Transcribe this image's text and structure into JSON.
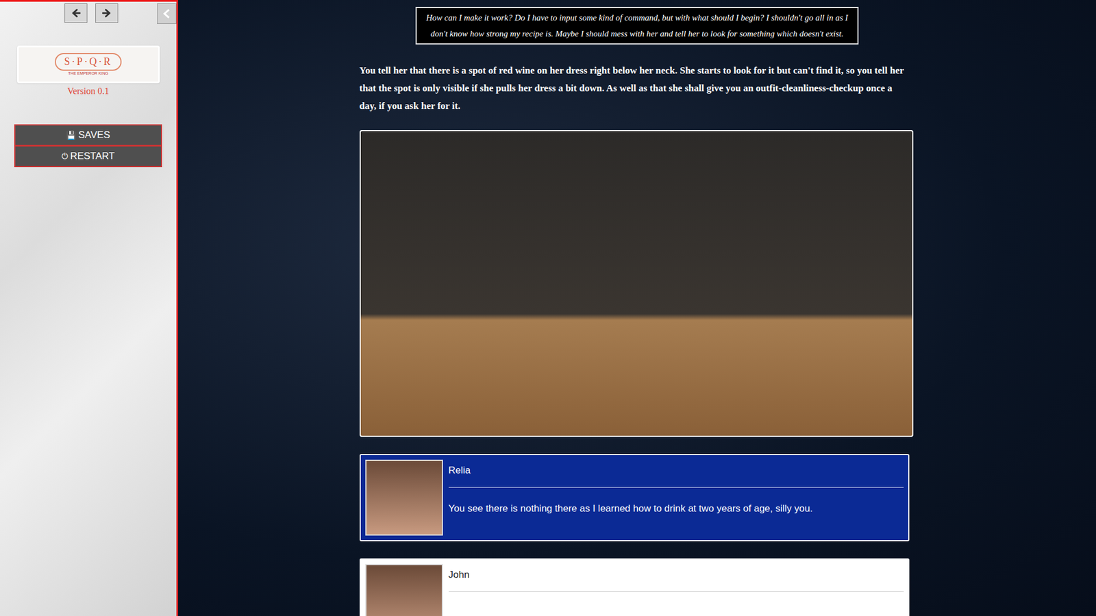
{
  "sidebar": {
    "logo": {
      "title": "S·P·Q·R",
      "subtitle": "THE EMPEROR KING"
    },
    "version": "Version 0.1",
    "buttons": [
      {
        "icon": "💾",
        "label": "SAVES"
      },
      {
        "icon": "⏻",
        "label": "RESTART"
      }
    ]
  },
  "story": {
    "thought": "How can I make it work? Do I have to input some kind of command, but with what should I begin? I shouldn't go all in as I don't know how strong my recipe is. Maybe I should mess with her and tell her to look for something which doesn't exist.",
    "narration": "You tell her that there is a spot of red wine on her dress right below her neck. She starts to look for it but can't find it, so you tell her that the spot is only visible if she pulls her dress a bit down. As well as that she shall give you an outfit-cleanliness-checkup once a day, if you ask her for it.",
    "dialogues": [
      {
        "speaker": "Relia",
        "text": "You see there is nothing there as I learned how to drink at two years of age, silly you.",
        "kind": "blue"
      },
      {
        "speaker": "John",
        "kind": "white"
      }
    ]
  }
}
